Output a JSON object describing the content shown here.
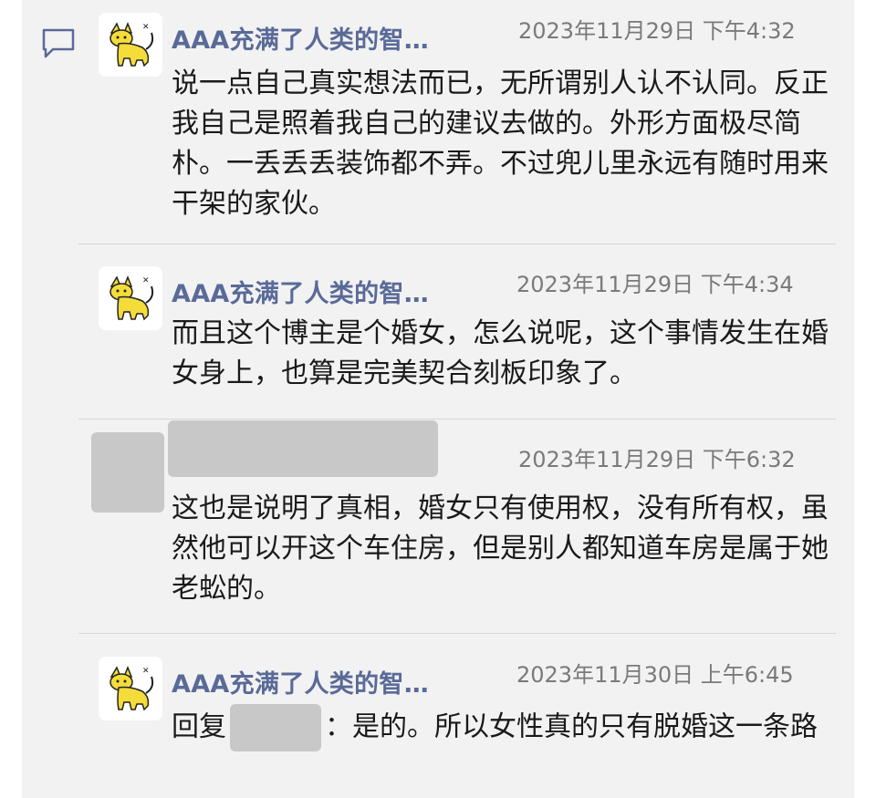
{
  "comments": [
    {
      "username": "AAA充满了人类的智…",
      "timestamp": "2023年11月29日 下午4:32",
      "content": "说一点自己真实想法而已，无所谓别人认不认同。反正我自己是照着我自己的建议去做的。外形方面极尽简朴。一丢丢丢装饰都不弄。不过兜儿里永远有随时用来干架的家伙。"
    },
    {
      "username": "AAA充满了人类的智…",
      "timestamp": "2023年11月29日 下午4:34",
      "content": "而且这个博主是个婚女，怎么说呢，这个事情发生在婚女身上，也算是完美契合刻板印象了。"
    },
    {
      "username": "",
      "timestamp": "2023年11月29日 下午6:32",
      "content": "这也是说明了真相，婚女只有使用权，没有所有权，虽然他可以开这个车住房，但是别人都知道车房是属于她老蚣的。"
    },
    {
      "username": "AAA充满了人类的智…",
      "timestamp": "2023年11月30日 上午6:45",
      "reply_prefix": "回复",
      "content": "：是的。所以女性真的只有脱婚这一条路"
    }
  ],
  "icons": {
    "comment": "speech-bubble-icon",
    "avatar": "yellow-cat-avatar"
  },
  "colors": {
    "username": "#5a6a98",
    "timestamp": "#7a7a7a",
    "background": "#f2f2f2"
  }
}
